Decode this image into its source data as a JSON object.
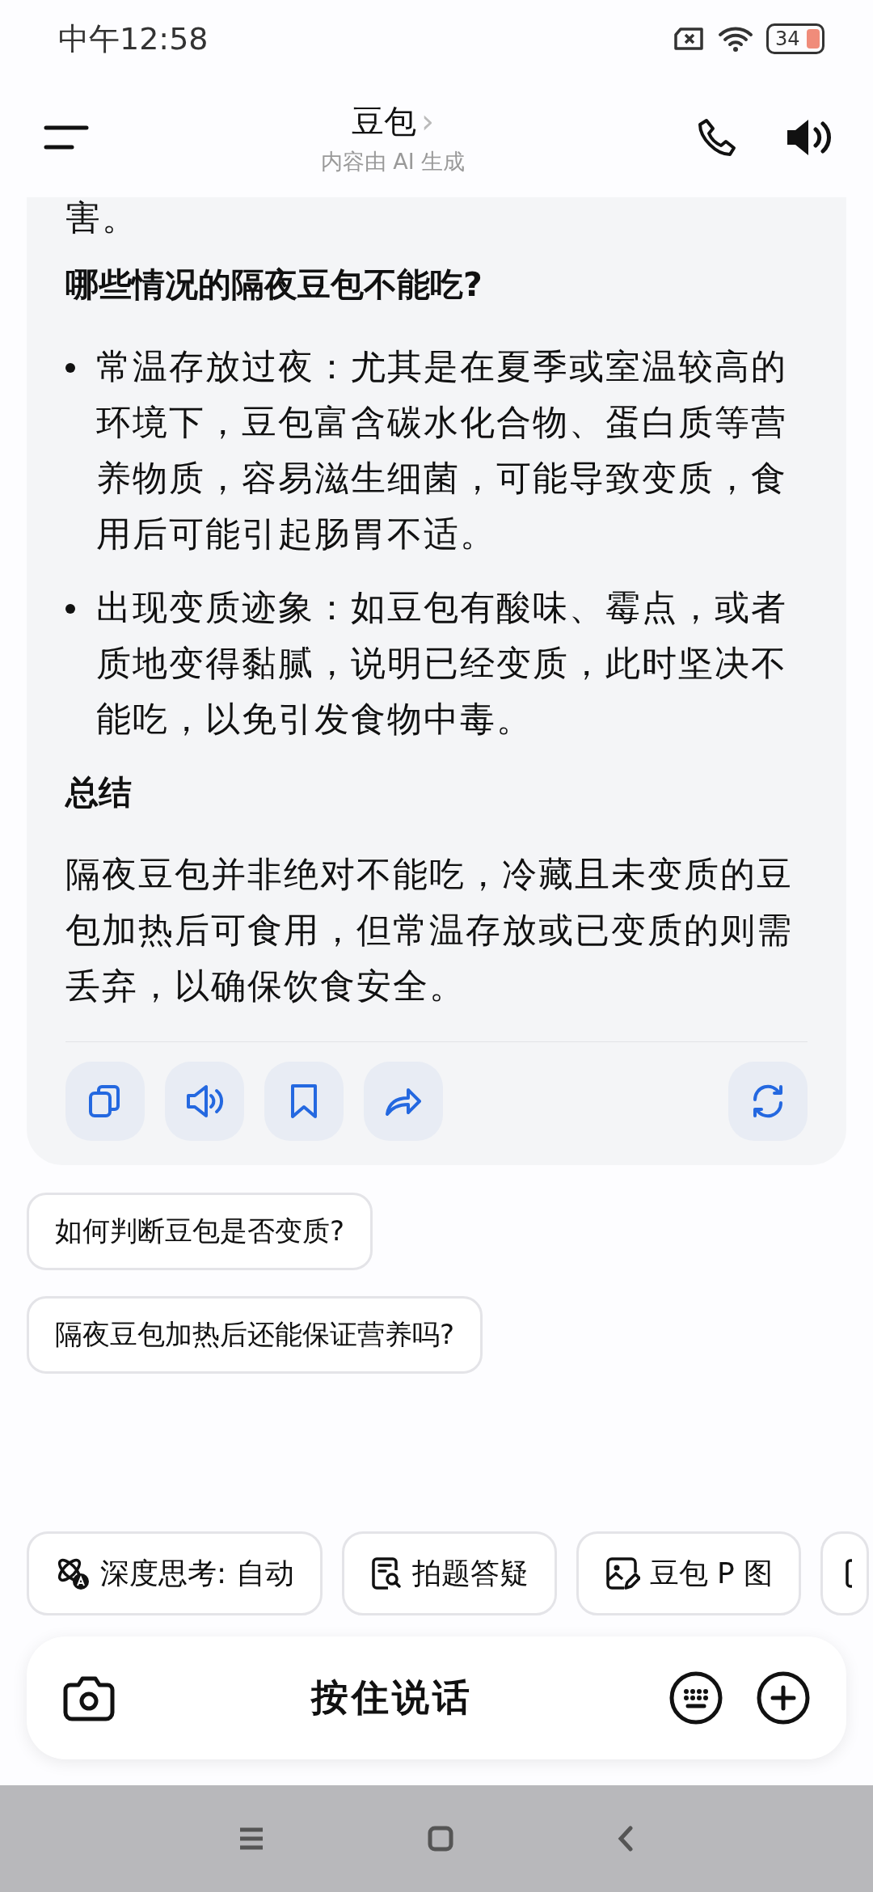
{
  "status_bar": {
    "time": "中午12:58",
    "battery": "34"
  },
  "header": {
    "title": "豆包",
    "chevron": "›",
    "subtitle": "内容由 AI 生成"
  },
  "message": {
    "blocks": [
      {
        "kind": "paragraph",
        "text": "害。"
      },
      {
        "kind": "heading",
        "text": "哪些情况的隔夜豆包不能吃?"
      },
      {
        "kind": "bullet",
        "text": "常温存放过夜：尤其是在夏季或室温较高的环境下，豆包富含碳水化合物、蛋白质等营养物质，容易滋生细菌，可能导致变质，食用后可能引起肠胃不适。"
      },
      {
        "kind": "bullet",
        "text": "出现变质迹象：如豆包有酸味、霉点，或者质地变得黏腻，说明已经变质，此时坚决不能吃，以免引发食物中毒。"
      },
      {
        "kind": "heading",
        "text": "总结"
      },
      {
        "kind": "paragraph",
        "text": "隔夜豆包并非绝对不能吃，冷藏且未变质的豆包加热后可食用，但常温存放或已变质的则需丢弃，以确保饮食安全。"
      }
    ]
  },
  "suggestions": [
    "如何判断豆包是否变质?",
    "隔夜豆包加热后还能保证营养吗?"
  ],
  "tools": [
    {
      "kind": "think",
      "label": "深度思考: 自动"
    },
    {
      "kind": "photo",
      "label": "拍题答疑"
    },
    {
      "kind": "image",
      "label": "豆包 P 图"
    }
  ],
  "input": {
    "label": "按住说话"
  }
}
